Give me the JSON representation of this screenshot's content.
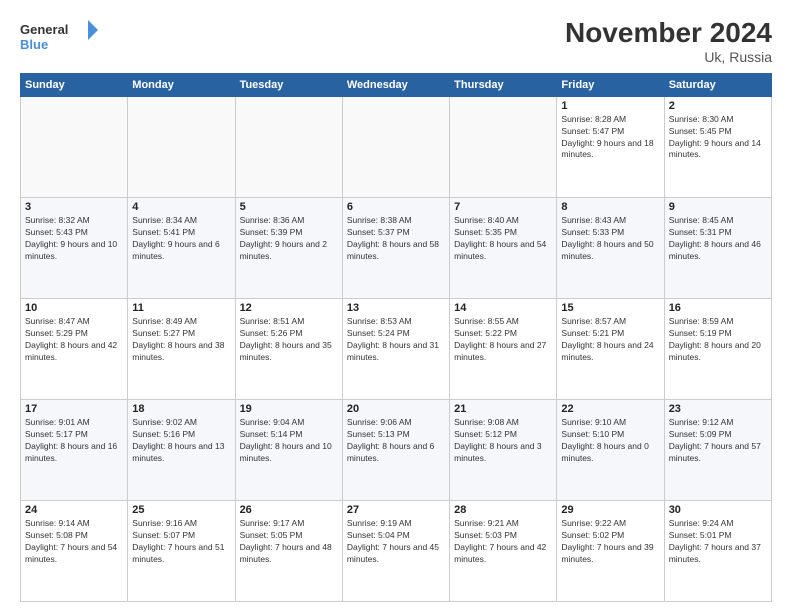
{
  "logo": {
    "line1": "General",
    "line2": "Blue"
  },
  "title": "November 2024",
  "subtitle": "Uk, Russia",
  "days_header": [
    "Sunday",
    "Monday",
    "Tuesday",
    "Wednesday",
    "Thursday",
    "Friday",
    "Saturday"
  ],
  "weeks": [
    [
      {
        "day": "",
        "info": ""
      },
      {
        "day": "",
        "info": ""
      },
      {
        "day": "",
        "info": ""
      },
      {
        "day": "",
        "info": ""
      },
      {
        "day": "",
        "info": ""
      },
      {
        "day": "1",
        "info": "Sunrise: 8:28 AM\nSunset: 5:47 PM\nDaylight: 9 hours and 18 minutes."
      },
      {
        "day": "2",
        "info": "Sunrise: 8:30 AM\nSunset: 5:45 PM\nDaylight: 9 hours and 14 minutes."
      }
    ],
    [
      {
        "day": "3",
        "info": "Sunrise: 8:32 AM\nSunset: 5:43 PM\nDaylight: 9 hours and 10 minutes."
      },
      {
        "day": "4",
        "info": "Sunrise: 8:34 AM\nSunset: 5:41 PM\nDaylight: 9 hours and 6 minutes."
      },
      {
        "day": "5",
        "info": "Sunrise: 8:36 AM\nSunset: 5:39 PM\nDaylight: 9 hours and 2 minutes."
      },
      {
        "day": "6",
        "info": "Sunrise: 8:38 AM\nSunset: 5:37 PM\nDaylight: 8 hours and 58 minutes."
      },
      {
        "day": "7",
        "info": "Sunrise: 8:40 AM\nSunset: 5:35 PM\nDaylight: 8 hours and 54 minutes."
      },
      {
        "day": "8",
        "info": "Sunrise: 8:43 AM\nSunset: 5:33 PM\nDaylight: 8 hours and 50 minutes."
      },
      {
        "day": "9",
        "info": "Sunrise: 8:45 AM\nSunset: 5:31 PM\nDaylight: 8 hours and 46 minutes."
      }
    ],
    [
      {
        "day": "10",
        "info": "Sunrise: 8:47 AM\nSunset: 5:29 PM\nDaylight: 8 hours and 42 minutes."
      },
      {
        "day": "11",
        "info": "Sunrise: 8:49 AM\nSunset: 5:27 PM\nDaylight: 8 hours and 38 minutes."
      },
      {
        "day": "12",
        "info": "Sunrise: 8:51 AM\nSunset: 5:26 PM\nDaylight: 8 hours and 35 minutes."
      },
      {
        "day": "13",
        "info": "Sunrise: 8:53 AM\nSunset: 5:24 PM\nDaylight: 8 hours and 31 minutes."
      },
      {
        "day": "14",
        "info": "Sunrise: 8:55 AM\nSunset: 5:22 PM\nDaylight: 8 hours and 27 minutes."
      },
      {
        "day": "15",
        "info": "Sunrise: 8:57 AM\nSunset: 5:21 PM\nDaylight: 8 hours and 24 minutes."
      },
      {
        "day": "16",
        "info": "Sunrise: 8:59 AM\nSunset: 5:19 PM\nDaylight: 8 hours and 20 minutes."
      }
    ],
    [
      {
        "day": "17",
        "info": "Sunrise: 9:01 AM\nSunset: 5:17 PM\nDaylight: 8 hours and 16 minutes."
      },
      {
        "day": "18",
        "info": "Sunrise: 9:02 AM\nSunset: 5:16 PM\nDaylight: 8 hours and 13 minutes."
      },
      {
        "day": "19",
        "info": "Sunrise: 9:04 AM\nSunset: 5:14 PM\nDaylight: 8 hours and 10 minutes."
      },
      {
        "day": "20",
        "info": "Sunrise: 9:06 AM\nSunset: 5:13 PM\nDaylight: 8 hours and 6 minutes."
      },
      {
        "day": "21",
        "info": "Sunrise: 9:08 AM\nSunset: 5:12 PM\nDaylight: 8 hours and 3 minutes."
      },
      {
        "day": "22",
        "info": "Sunrise: 9:10 AM\nSunset: 5:10 PM\nDaylight: 8 hours and 0 minutes."
      },
      {
        "day": "23",
        "info": "Sunrise: 9:12 AM\nSunset: 5:09 PM\nDaylight: 7 hours and 57 minutes."
      }
    ],
    [
      {
        "day": "24",
        "info": "Sunrise: 9:14 AM\nSunset: 5:08 PM\nDaylight: 7 hours and 54 minutes."
      },
      {
        "day": "25",
        "info": "Sunrise: 9:16 AM\nSunset: 5:07 PM\nDaylight: 7 hours and 51 minutes."
      },
      {
        "day": "26",
        "info": "Sunrise: 9:17 AM\nSunset: 5:05 PM\nDaylight: 7 hours and 48 minutes."
      },
      {
        "day": "27",
        "info": "Sunrise: 9:19 AM\nSunset: 5:04 PM\nDaylight: 7 hours and 45 minutes."
      },
      {
        "day": "28",
        "info": "Sunrise: 9:21 AM\nSunset: 5:03 PM\nDaylight: 7 hours and 42 minutes."
      },
      {
        "day": "29",
        "info": "Sunrise: 9:22 AM\nSunset: 5:02 PM\nDaylight: 7 hours and 39 minutes."
      },
      {
        "day": "30",
        "info": "Sunrise: 9:24 AM\nSunset: 5:01 PM\nDaylight: 7 hours and 37 minutes."
      }
    ]
  ]
}
